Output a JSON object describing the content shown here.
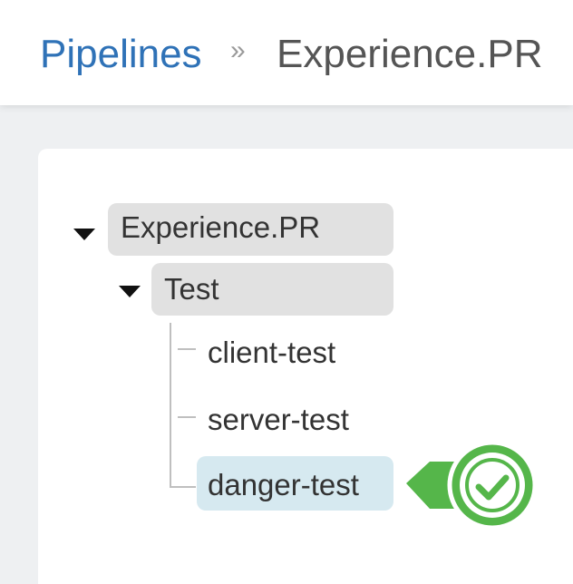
{
  "breadcrumb": {
    "parent": "Pipelines",
    "separator": "»",
    "current": "Experience.PR"
  },
  "tree": {
    "root": {
      "label": "Experience.PR",
      "expanded": true
    },
    "stage": {
      "label": "Test",
      "expanded": true
    },
    "jobs": [
      {
        "label": "client-test",
        "selected": false
      },
      {
        "label": "server-test",
        "selected": false
      },
      {
        "label": "danger-test",
        "selected": true
      }
    ]
  },
  "status": {
    "icon": "check-icon",
    "state": "success",
    "color": "#55b64a"
  },
  "colors": {
    "link": "#2f72b7",
    "node_bg": "#e1e1e1",
    "selected_bg": "#d6e9f0",
    "success": "#55b64a"
  }
}
